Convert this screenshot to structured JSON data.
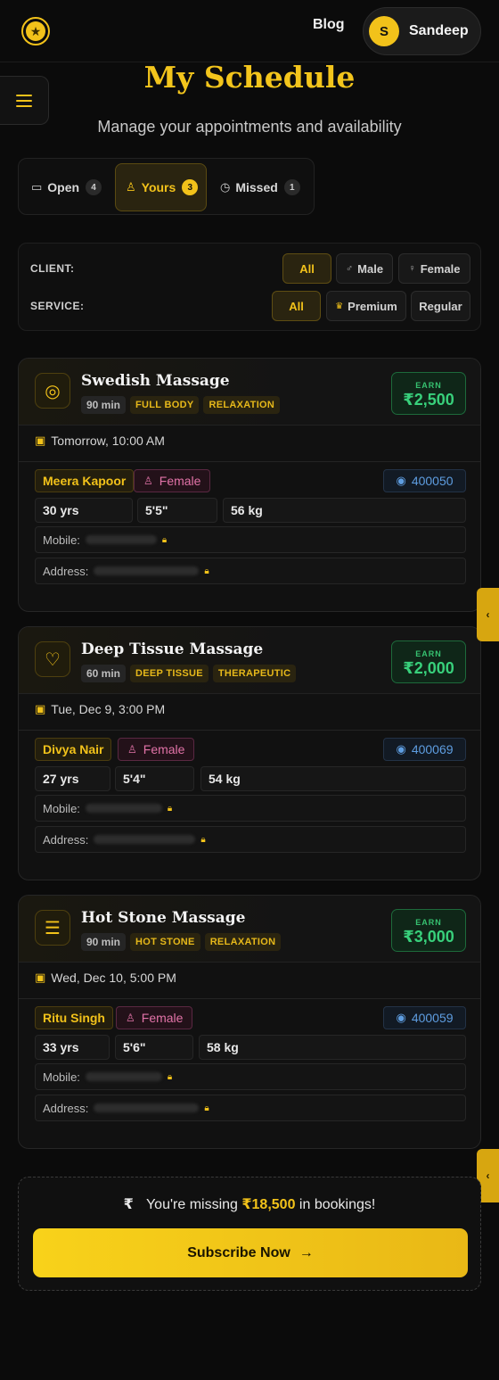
{
  "header": {
    "logo_icon": "star-icon",
    "blog_label": "Blog",
    "user": {
      "initial": "S",
      "name": "Sandeep"
    }
  },
  "page": {
    "title": "My Schedule",
    "subtitle": "Manage your appointments and availability"
  },
  "tabs": [
    {
      "label": "Open",
      "count": "4",
      "icon": "chat-icon"
    },
    {
      "label": "Yours",
      "count": "3",
      "icon": "user-icon"
    },
    {
      "label": "Missed",
      "count": "1",
      "icon": "clock-icon"
    }
  ],
  "filters": {
    "client": {
      "label": "CLIENT:",
      "options": [
        "All",
        "Male",
        "Female"
      ],
      "selected": "All"
    },
    "service": {
      "label": "SERVICE:",
      "options": [
        "All",
        "Premium",
        "Regular"
      ],
      "selected": "All"
    }
  },
  "appointments": [
    {
      "service": "Swedish Massage",
      "duration": "90 min",
      "tags": [
        "FULL BODY",
        "RELAXATION"
      ],
      "earn_label": "EARN",
      "earn": "₹2,500",
      "when": "Tomorrow, 10:00 AM",
      "client": "Meera Kapoor",
      "gender": "Female",
      "pincode": "400050",
      "age": "30 yrs",
      "height": "5'5\"",
      "weight": "56 kg",
      "mobile_label": "Mobile:",
      "address_label": "Address:"
    },
    {
      "service": "Deep Tissue Massage",
      "duration": "60 min",
      "tags": [
        "DEEP TISSUE",
        "THERAPEUTIC"
      ],
      "earn_label": "EARN",
      "earn": "₹2,000",
      "when": "Tue, Dec 9, 3:00 PM",
      "client": "Divya Nair",
      "gender": "Female",
      "pincode": "400069",
      "age": "27 yrs",
      "height": "5'4\"",
      "weight": "54 kg",
      "mobile_label": "Mobile:",
      "address_label": "Address:"
    },
    {
      "service": "Hot Stone Massage",
      "duration": "90 min",
      "tags": [
        "HOT STONE",
        "RELAXATION"
      ],
      "earn_label": "EARN",
      "earn": "₹3,000",
      "when": "Wed, Dec 10, 5:00 PM",
      "client": "Ritu Singh",
      "gender": "Female",
      "pincode": "400059",
      "age": "33 yrs",
      "height": "5'6\"",
      "weight": "58 kg",
      "mobile_label": "Mobile:",
      "address_label": "Address:"
    }
  ],
  "promo": {
    "prefix": "You're missing",
    "amount": "₹18,500",
    "suffix": "in bookings!",
    "button": "Subscribe Now"
  }
}
